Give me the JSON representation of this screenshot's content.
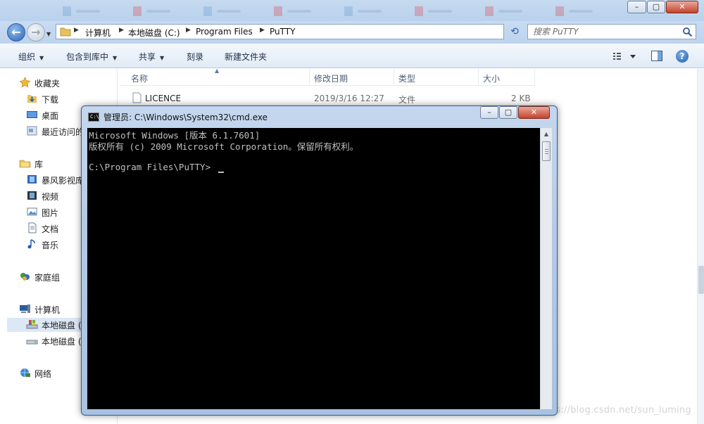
{
  "explorer": {
    "address": {
      "crumbs": [
        "计算机",
        "本地磁盘 (C:)",
        "Program Files",
        "PuTTY"
      ]
    },
    "search": {
      "placeholder": "搜索 PuTTY"
    },
    "toolbar": {
      "organize": "组织",
      "include_in_library": "包含到库中",
      "share": "共享",
      "burn": "刻录",
      "new_folder": "新建文件夹"
    },
    "nav": {
      "favorites": "收藏夹",
      "downloads": "下载",
      "desktop": "桌面",
      "recent": "最近访问的位置",
      "libraries": "库",
      "baofeng": "暴风影视库",
      "videos": "视频",
      "pictures": "图片",
      "documents": "文档",
      "music": "音乐",
      "homegroup": "家庭组",
      "computer": "计算机",
      "local_disk_c": "本地磁盘 (C:)",
      "local_disk_d": "本地磁盘 (D:)",
      "network": "网络"
    },
    "columns": {
      "name": "名称",
      "modified": "修改日期",
      "type": "类型",
      "size": "大小"
    },
    "files": [
      {
        "name": "LICENCE",
        "modified": "2019/3/16 12:27",
        "type": "文件",
        "size": "2 KB"
      }
    ]
  },
  "cmd": {
    "title": "管理员: C:\\Windows\\System32\\cmd.exe",
    "icon_text": "C:\\",
    "lines": [
      "Microsoft Windows [版本 6.1.7601]",
      "版权所有 (c) 2009 Microsoft Corporation。保留所有权利。",
      "",
      "C:\\Program Files\\PuTTY>"
    ]
  },
  "watermark": "https://blog.csdn.net/sun_luming",
  "colors": {
    "console_bg": "#000000",
    "console_text": "#c0c0c0",
    "chrome_blue": "#b9d1ec",
    "close_red": "#c4432b"
  }
}
